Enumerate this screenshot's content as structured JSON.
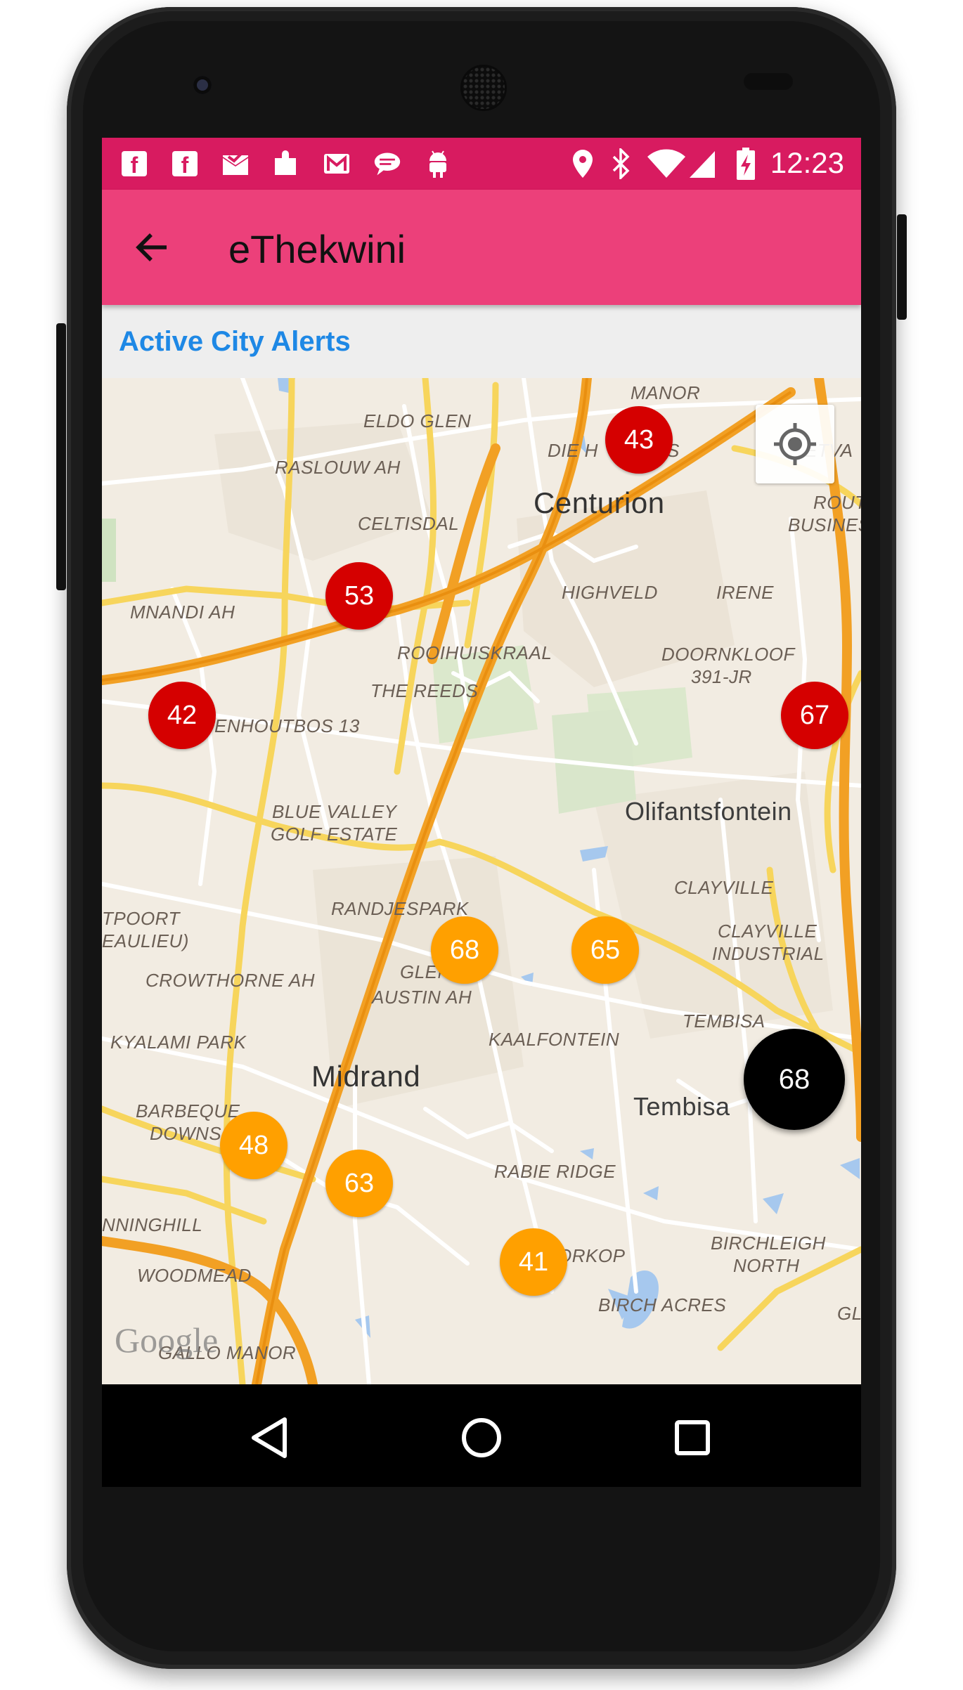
{
  "statusbar": {
    "notification_icons": [
      "facebook-icon",
      "facebook-icon",
      "mail-check-icon",
      "puzzle-icon",
      "gmail-icon",
      "message-icon",
      "android-icon"
    ],
    "system_icons": [
      "location-icon",
      "bluetooth-icon",
      "wifi-icon",
      "signal-icon",
      "battery-charging-icon"
    ],
    "time": "12:23",
    "color": "#d81b60"
  },
  "appbar": {
    "title": "eThekwini",
    "color": "#ec407a"
  },
  "subheader": {
    "label": "Active City Alerts",
    "color": "#1e88e5"
  },
  "map": {
    "labels": [
      {
        "text": "MANOR"
      },
      {
        "text": "ELDO GLEN"
      },
      {
        "text": "DIE H"
      },
      {
        "text": "S"
      },
      {
        "text": "RASLOUW AH"
      },
      {
        "text": "Centurion"
      },
      {
        "text": "ROUT"
      },
      {
        "text": "BUSINES"
      },
      {
        "text": "ETVA"
      },
      {
        "text": "CELTISDAL"
      },
      {
        "text": "HIGHVELD"
      },
      {
        "text": "IRENE"
      },
      {
        "text": "MNANDI AH"
      },
      {
        "text": "ROOIHUISKRAAL"
      },
      {
        "text": "DOORNKLOOF"
      },
      {
        "text": "391-JR"
      },
      {
        "text": "THE REEDS"
      },
      {
        "text": "ENHOUTBOS 13"
      },
      {
        "text": "BLUE VALLEY"
      },
      {
        "text": "GOLF ESTATE"
      },
      {
        "text": "Olifantsfontein"
      },
      {
        "text": "CLAYVILLE"
      },
      {
        "text": "TPOORT"
      },
      {
        "text": "EAULIEU)"
      },
      {
        "text": "RANDJESPARK"
      },
      {
        "text": "CLAYVILLE"
      },
      {
        "text": "INDUSTRIAL"
      },
      {
        "text": "CROWTHORNE AH"
      },
      {
        "text": "GLEN"
      },
      {
        "text": "AUSTIN AH"
      },
      {
        "text": "TEMBISA"
      },
      {
        "text": "KYALAMI PARK"
      },
      {
        "text": "KAALFONTEIN"
      },
      {
        "text": "Midrand"
      },
      {
        "text": "Tembisa"
      },
      {
        "text": "BARBEQUE"
      },
      {
        "text": "DOWNS"
      },
      {
        "text": "RABIE RIDGE"
      },
      {
        "text": "NNINGHILL"
      },
      {
        "text": "BIRCHLEIGH"
      },
      {
        "text": "NORTH"
      },
      {
        "text": "ORKOP"
      },
      {
        "text": "WOODMEAD"
      },
      {
        "text": "BIRCH ACRES"
      },
      {
        "text": "GALLO MANOR"
      },
      {
        "text": "GL"
      }
    ],
    "markers": [
      {
        "value": "43",
        "color": "#d50000"
      },
      {
        "value": "53",
        "color": "#d50000"
      },
      {
        "value": "42",
        "color": "#d50000"
      },
      {
        "value": "67",
        "color": "#d50000"
      },
      {
        "value": "68",
        "color": "#ffa000"
      },
      {
        "value": "65",
        "color": "#ffa000"
      },
      {
        "value": "48",
        "color": "#ffa000"
      },
      {
        "value": "63",
        "color": "#ffa000"
      },
      {
        "value": "41",
        "color": "#ffa000"
      }
    ],
    "locate_icon": "my-location-icon",
    "attribution": "Google"
  },
  "fab": {
    "label": "68"
  },
  "navbar": {
    "buttons": [
      "back-triangle-icon",
      "home-circle-icon",
      "recents-square-icon"
    ]
  }
}
